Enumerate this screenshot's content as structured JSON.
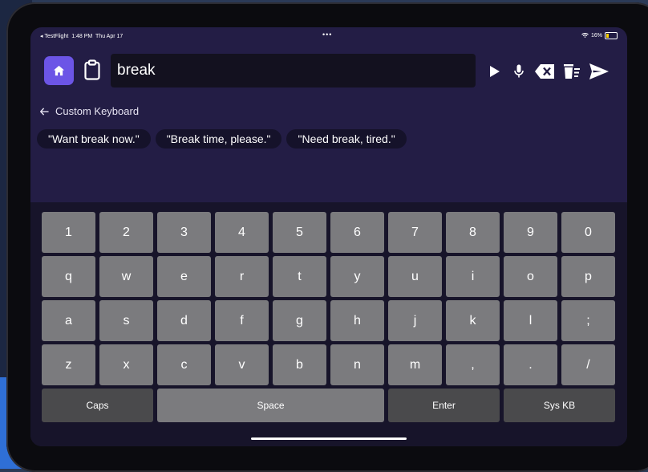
{
  "status_bar": {
    "back_app": "◂ TestFlight",
    "time": "1:48 PM",
    "date": "Thu Apr 17",
    "dots": "•••",
    "battery": "16%"
  },
  "toolbar": {
    "input_value": "break",
    "icons": [
      "home-icon",
      "clipboard-icon",
      "play-icon",
      "microphone-icon",
      "backspace-icon",
      "clear-icon",
      "send-icon"
    ]
  },
  "nav": {
    "back_label": "Custom Keyboard"
  },
  "suggestions": [
    "\"Want break now.\"",
    "\"Break time, please.\"",
    "\"Need break, tired.\""
  ],
  "keyboard": {
    "rows": [
      [
        "1",
        "2",
        "3",
        "4",
        "5",
        "6",
        "7",
        "8",
        "9",
        "0"
      ],
      [
        "q",
        "w",
        "e",
        "r",
        "t",
        "y",
        "u",
        "i",
        "o",
        "p"
      ],
      [
        "a",
        "s",
        "d",
        "f",
        "g",
        "h",
        "j",
        "k",
        "l",
        ";"
      ],
      [
        "z",
        "x",
        "c",
        "v",
        "b",
        "n",
        "m",
        ",",
        ".",
        "/"
      ]
    ],
    "function_keys": {
      "caps": "Caps",
      "space": "Space",
      "enter": "Enter",
      "sys_kb": "Sys KB"
    }
  },
  "colors": {
    "screen_bg": "#231d45",
    "accent": "#6c55e6",
    "key_bg": "#7b7b7e",
    "keyboard_bg": "#17142a"
  }
}
